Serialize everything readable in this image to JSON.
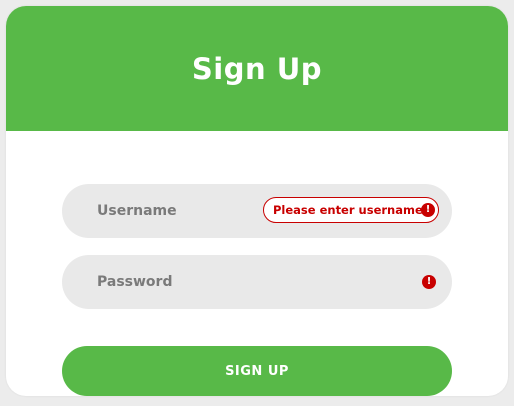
{
  "header": {
    "title": "Sign Up"
  },
  "form": {
    "username": {
      "placeholder": "Username",
      "value": "",
      "error_message": "Please enter username",
      "error_icon": "exclamation-circle-icon"
    },
    "password": {
      "placeholder": "Password",
      "value": "",
      "error_icon": "exclamation-circle-icon"
    },
    "submit_label": "SIGN UP"
  },
  "colors": {
    "brand_green": "#58b948",
    "error_red": "#c80000",
    "field_background": "#e9e9e9"
  }
}
